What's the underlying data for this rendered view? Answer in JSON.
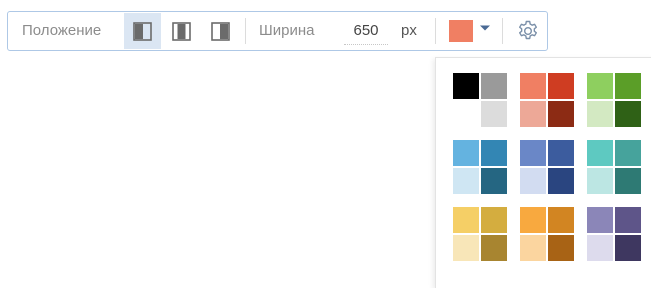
{
  "toolbar": {
    "position_label": "Положение",
    "width_label": "Ширина",
    "width_value": "650",
    "width_unit": "px",
    "position_options": [
      {
        "name": "align-left",
        "selected": true
      },
      {
        "name": "align-center",
        "selected": false
      },
      {
        "name": "align-right",
        "selected": false
      }
    ],
    "selected_color": "#f07f63",
    "icons": {
      "color_dropdown": "chevron-down-icon",
      "settings": "gear-icon"
    }
  },
  "palette": {
    "groups": [
      {
        "name": "gray",
        "colors": [
          "#000000",
          "#9a9a9a",
          "#ffffff",
          "#dcdcdc"
        ]
      },
      {
        "name": "red",
        "colors": [
          "#f07f63",
          "#cf3d22",
          "#eda897",
          "#8c2b14"
        ]
      },
      {
        "name": "green",
        "colors": [
          "#8ecf5f",
          "#5b9e28",
          "#d3e9c2",
          "#2f6116"
        ]
      },
      {
        "name": "blue",
        "colors": [
          "#64b3e0",
          "#3386b4",
          "#cfe6f3",
          "#256682"
        ]
      },
      {
        "name": "indigo",
        "colors": [
          "#6a87c7",
          "#3c5c9e",
          "#d2dcf1",
          "#2a4580"
        ]
      },
      {
        "name": "teal",
        "colors": [
          "#5ec9c1",
          "#46a39c",
          "#bce6e3",
          "#2e7a74"
        ]
      },
      {
        "name": "yellow",
        "colors": [
          "#f5cf66",
          "#d4ad3f",
          "#f8e6b8",
          "#a88530"
        ]
      },
      {
        "name": "orange",
        "colors": [
          "#f8a93f",
          "#d28522",
          "#fbd59f",
          "#a86315"
        ]
      },
      {
        "name": "purple",
        "colors": [
          "#8b86b8",
          "#5e5589",
          "#dddbed",
          "#3e3760"
        ]
      }
    ]
  }
}
